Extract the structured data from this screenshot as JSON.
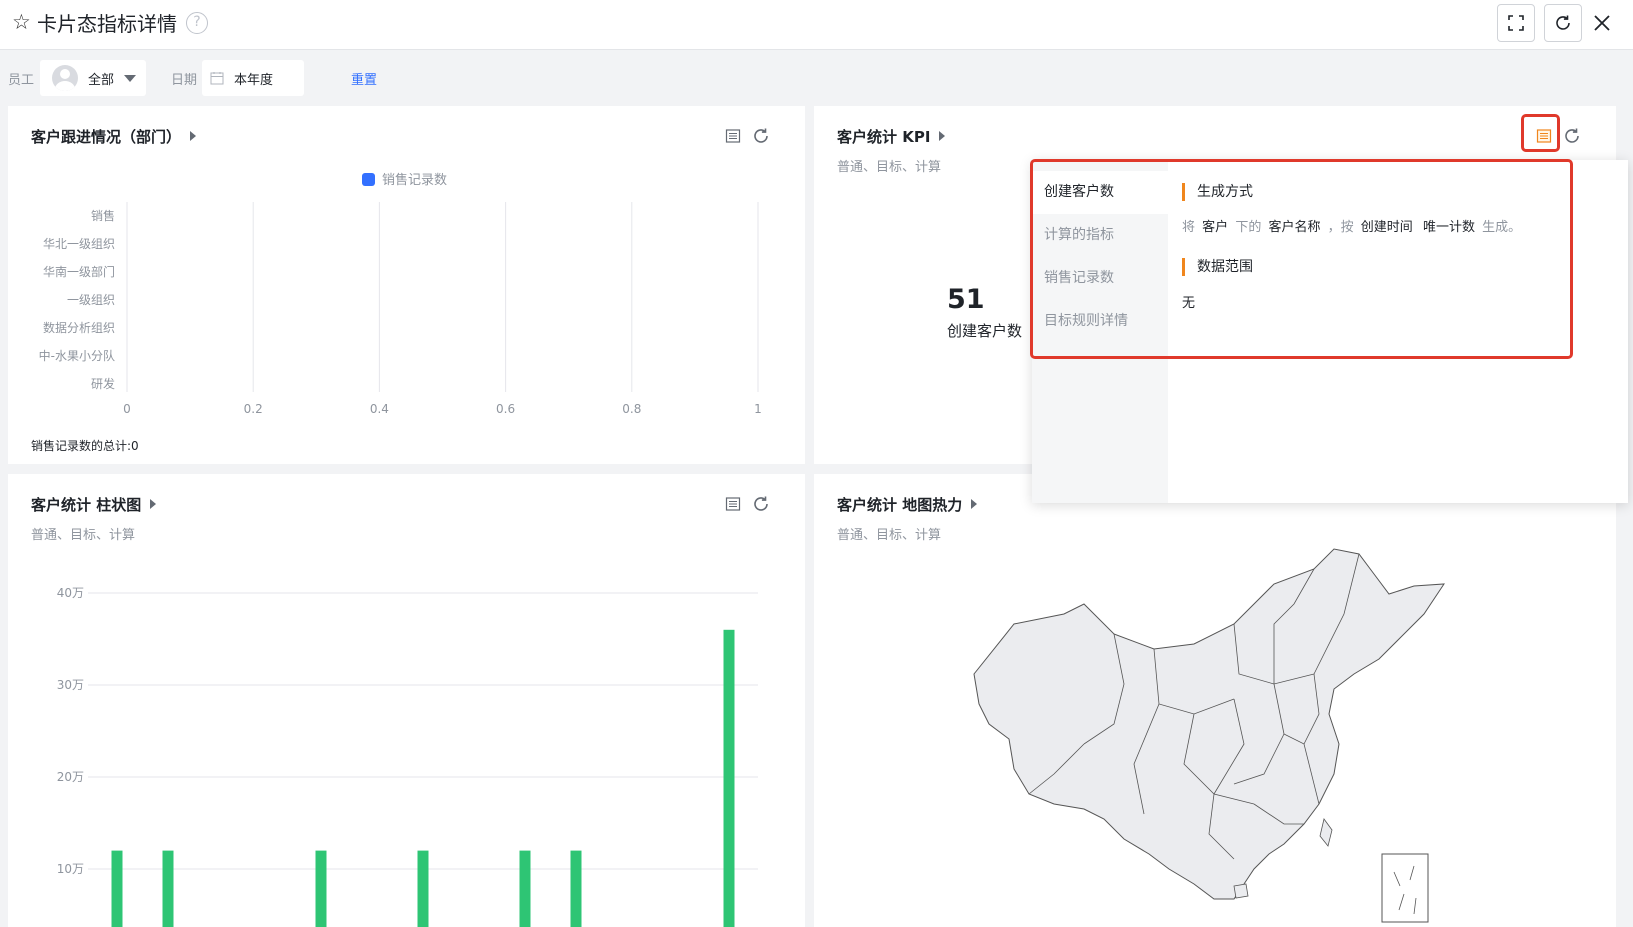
{
  "header": {
    "title": "卡片态指标详情",
    "help": "?",
    "icons": [
      "star-icon",
      "help-icon",
      "fullscreen-icon",
      "refresh-icon",
      "close-icon"
    ]
  },
  "filters": {
    "employee_label": "员工",
    "employee_value": "全部",
    "date_label": "日期",
    "date_value": "本年度",
    "reset": "重置"
  },
  "cards": {
    "followup": {
      "title": "客户跟进情况（部门）",
      "legend": "销售记录数",
      "footer": "销售记录数的总计:0"
    },
    "kpi": {
      "title": "客户统计 KPI",
      "subtitle": "普通、目标、计算",
      "value": "51",
      "label": "创建客户数"
    },
    "bar": {
      "title": "客户统计 柱状图",
      "subtitle": "普通、目标、计算"
    },
    "map": {
      "title": "客户统计 地图热力",
      "subtitle": "普通、目标、计算"
    }
  },
  "popover": {
    "tabs": [
      "创建客户数",
      "计算的指标",
      "销售记录数",
      "目标规则详情"
    ],
    "active_tab": 0,
    "gen_heading": "生成方式",
    "gen_parts": [
      "将",
      "客户",
      "下的",
      "客户名称",
      "，按",
      "创建时间",
      "唯一计数",
      "生成。"
    ],
    "range_heading": "数据范围",
    "range_value": "无"
  },
  "chart_data": [
    {
      "type": "bar",
      "orientation": "horizontal",
      "title": "客户跟进情况（部门）",
      "categories": [
        "销售",
        "华北一级组织",
        "华南一级部门",
        "一级组织",
        "数据分析组织",
        "中-水果小分队",
        "研发"
      ],
      "series": [
        {
          "name": "销售记录数",
          "values": [
            0,
            0,
            0,
            0,
            0,
            0,
            0
          ]
        }
      ],
      "x_ticks": [
        "0",
        "0.2",
        "0.4",
        "0.6",
        "0.8",
        "1"
      ],
      "xlim": [
        0,
        1
      ],
      "legend": "top-center",
      "grid": true,
      "color": "#3370ff"
    },
    {
      "type": "bar",
      "title": "客户统计 柱状图",
      "y_ticks": [
        "10万",
        "20万",
        "30万",
        "40万"
      ],
      "ylim": [
        0,
        400000
      ],
      "values": [
        120000,
        120000,
        null,
        null,
        120000,
        null,
        120000,
        null,
        120000,
        120000,
        null,
        null,
        360000
      ],
      "grid": true,
      "color": "#2ec574"
    }
  ]
}
